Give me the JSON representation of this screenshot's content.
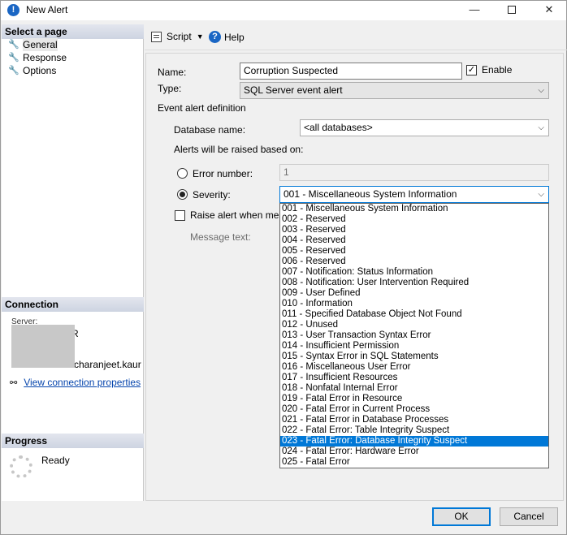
{
  "window": {
    "title": "New Alert",
    "title_icon": "alert-info-icon",
    "controls": {
      "minimize": "—",
      "maximize": "",
      "close": "✕"
    }
  },
  "left_pane": {
    "select_page_header": "Select a page",
    "pages": [
      {
        "label": "General",
        "icon": "wrench-icon",
        "selected": true
      },
      {
        "label": "Response",
        "icon": "wrench-icon",
        "selected": false
      },
      {
        "label": "Options",
        "icon": "wrench-icon",
        "selected": false
      }
    ],
    "connection_header": "Connection",
    "connection": {
      "server_label": "Server:",
      "server_value_suffix": "R",
      "user_suffix": "charanjeet.kaur",
      "view_properties_link": "View connection properties",
      "icon": "connection-icon"
    },
    "progress_header": "Progress",
    "progress_status": "Ready"
  },
  "toolbar": {
    "script_label": "Script",
    "help_label": "Help"
  },
  "form": {
    "name_label": "Name:",
    "name_value": "Corruption Suspected",
    "enable_label": "Enable",
    "enable_checked": true,
    "type_label": "Type:",
    "type_value": "SQL Server event alert",
    "event_alert_definition_label": "Event alert definition",
    "database_name_label": "Database name:",
    "database_name_value": "<all databases>",
    "alerts_raised_label": "Alerts will be raised based on:",
    "error_number_label": "Error number:",
    "error_number_value": "1",
    "severity_label": "Severity:",
    "severity_value": "001 - Miscellaneous System Information",
    "raise_alert_label": "Raise alert when messa",
    "message_text_label": "Message text:"
  },
  "severity_options": [
    "001 - Miscellaneous System Information",
    "002 - Reserved",
    "003 - Reserved",
    "004 - Reserved",
    "005 - Reserved",
    "006 - Reserved",
    "007 - Notification: Status Information",
    "008 - Notification: User Intervention Required",
    "009 - User Defined",
    "010 - Information",
    "011 - Specified Database Object Not Found",
    "012 - Unused",
    "013 - User Transaction Syntax Error",
    "014 - Insufficient Permission",
    "015 - Syntax Error in SQL Statements",
    "016 - Miscellaneous User Error",
    "017 - Insufficient Resources",
    "018 - Nonfatal Internal Error",
    "019 - Fatal Error in Resource",
    "020 - Fatal Error in Current Process",
    "021 - Fatal Error in Database Processes",
    "022 - Fatal Error: Table Integrity Suspect",
    "023 - Fatal Error: Database Integrity Suspect",
    "024 - Fatal Error: Hardware Error",
    "025 - Fatal Error"
  ],
  "highlighted_option_index": 22,
  "buttons": {
    "ok": "OK",
    "cancel": "Cancel"
  },
  "colors": {
    "accent": "#0078d7",
    "link": "#0645ad",
    "header_bg": "#cdd4e1"
  }
}
